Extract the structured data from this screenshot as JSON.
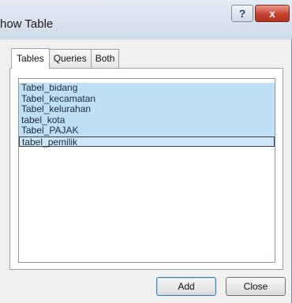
{
  "window": {
    "title": "how Table",
    "help_label": "?",
    "close_label": "x"
  },
  "tabs": [
    {
      "label": "Tables",
      "active": true
    },
    {
      "label": "Queries",
      "active": false
    },
    {
      "label": "Both",
      "active": false
    }
  ],
  "tables": [
    {
      "label": "Tabel_bidang",
      "selected": true
    },
    {
      "label": "Tabel_kecamatan",
      "selected": true
    },
    {
      "label": "Tabel_kelurahan",
      "selected": true
    },
    {
      "label": "tabel_kota",
      "selected": true
    },
    {
      "label": "Tabel_PAJAK",
      "selected": true
    },
    {
      "label": "tabel_pemilik",
      "selected": true,
      "focused": true
    }
  ],
  "buttons": {
    "add_label": "Add",
    "close_label": "Close"
  },
  "colors": {
    "selection": "#bfdff6",
    "close_button": "#c4422f",
    "title_bar": "#dbe4ef"
  }
}
